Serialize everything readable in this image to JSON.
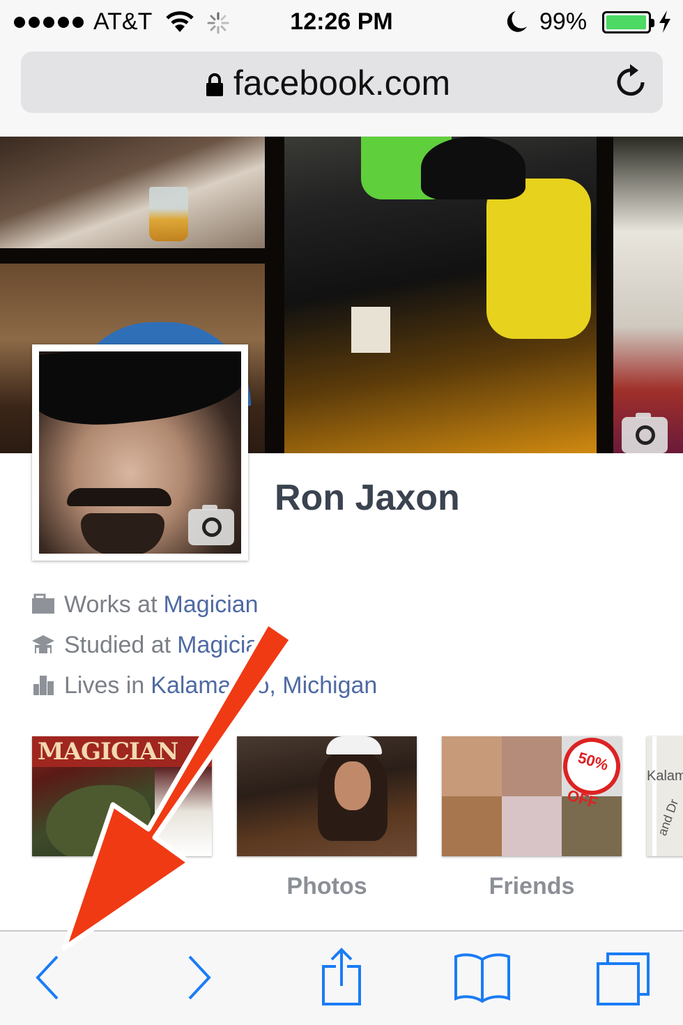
{
  "status_bar": {
    "carrier": "AT&T",
    "time": "12:26 PM",
    "battery_percent": "99%",
    "battery_level": 0.99,
    "signal_bars": 5,
    "icons": [
      "signal-dots-icon",
      "wifi-icon",
      "activity-spinner-icon",
      "do-not-disturb-moon-icon",
      "battery-icon",
      "charging-bolt-icon"
    ]
  },
  "browser": {
    "url": "facebook.com",
    "secure": true,
    "icons": [
      "lock-icon",
      "reload-icon"
    ]
  },
  "profile": {
    "name": "Ron Jaxon",
    "intro": [
      {
        "icon": "briefcase-icon",
        "prefix": "Works at",
        "link": "Magician"
      },
      {
        "icon": "graduation-cap-icon",
        "prefix": "Studied at",
        "link": "Magician"
      },
      {
        "icon": "city-icon",
        "prefix": "Lives in",
        "link": "Kalamazoo, Michigan"
      }
    ]
  },
  "tiles": {
    "about_banner": "MAGICIAN",
    "friends_badge": "50% OFF",
    "map_text": "Kalam",
    "map_street": "and Dr",
    "photos_label": "Photos",
    "friends_label": "Friends"
  },
  "toolbar": {
    "icons": [
      "back-chevron-icon",
      "forward-chevron-icon",
      "share-icon",
      "bookmarks-book-icon",
      "tabs-icon"
    ]
  },
  "colors": {
    "link": "#4f6aa3",
    "name": "#3b4350",
    "ios_blue": "#1a7cf5",
    "annotation_red": "#f03a14",
    "battery_green": "#4cd964"
  }
}
